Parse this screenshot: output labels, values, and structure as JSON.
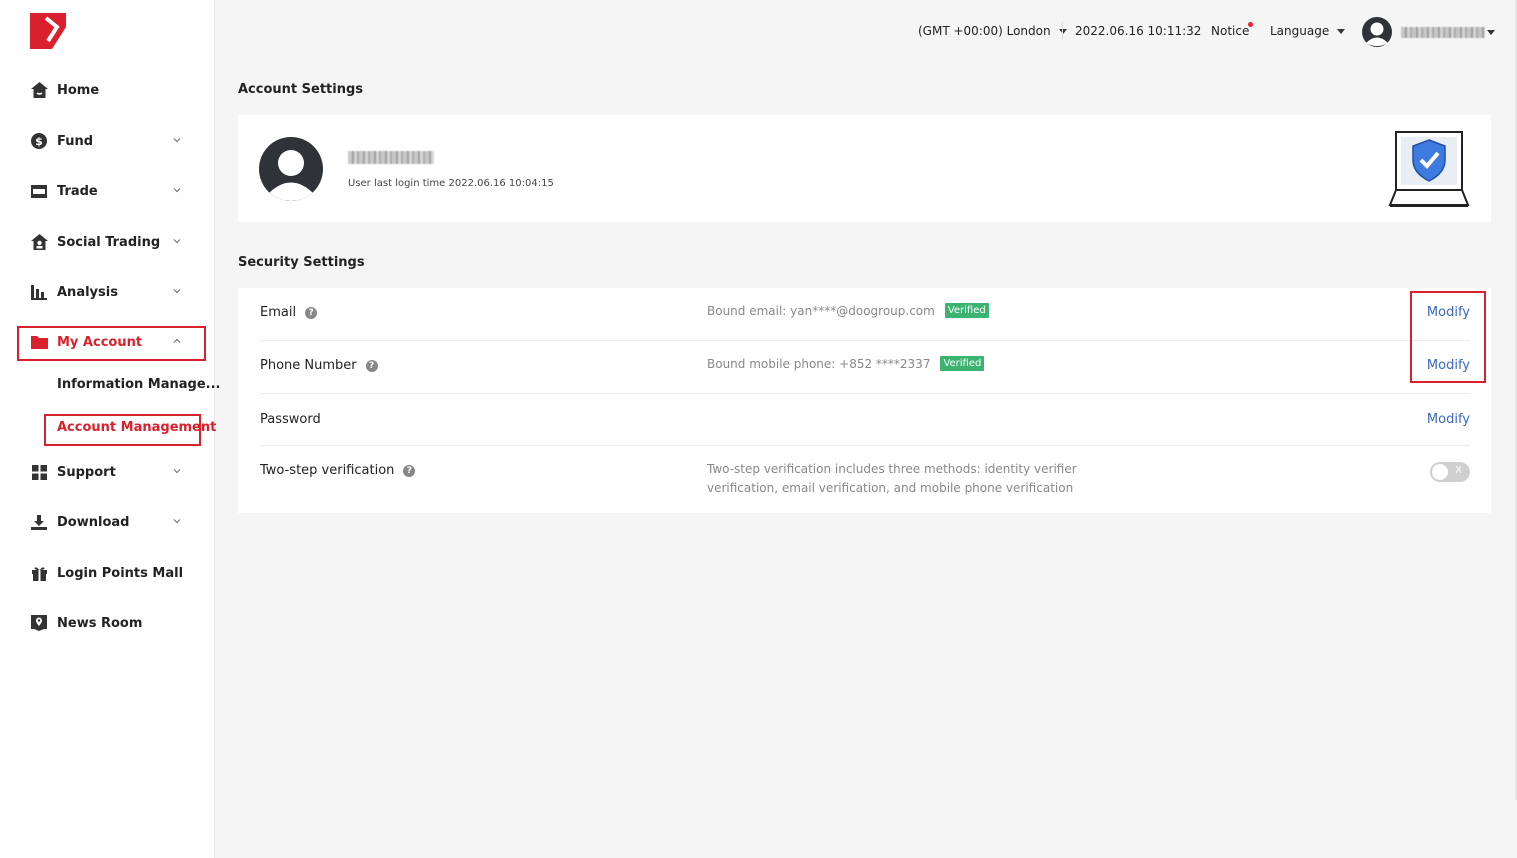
{
  "brand": {
    "accent": "#d8212c",
    "link": "#3a67c4",
    "badge_green": "#3cb371"
  },
  "sidebar": {
    "items": [
      {
        "label": "Home",
        "icon": "home-icon"
      },
      {
        "label": "Fund",
        "icon": "dollar-icon"
      },
      {
        "label": "Trade",
        "icon": "trade-card-icon"
      },
      {
        "label": "Social Trading",
        "icon": "social-house-icon"
      },
      {
        "label": "Analysis",
        "icon": "bar-chart-icon"
      },
      {
        "label": "My Account",
        "icon": "folder-icon"
      },
      {
        "label": "Support",
        "icon": "grid-icon"
      },
      {
        "label": "Download",
        "icon": "download-icon"
      },
      {
        "label": "Login Points Mall",
        "icon": "gift-icon"
      },
      {
        "label": "News Room",
        "icon": "news-pin-icon"
      }
    ],
    "sub_items": [
      {
        "label": "Information Manage..."
      },
      {
        "label": "Account Management"
      }
    ]
  },
  "topbar": {
    "timezone": "(GMT +00:00) London",
    "datetime": "2022.06.16 10:11:32",
    "notice": "Notice",
    "language": "Language"
  },
  "account": {
    "section_title": "Account Settings",
    "last_login": "User last login time 2022.06.16 10:04:15"
  },
  "security": {
    "section_title": "Security Settings",
    "rows": [
      {
        "label": "Email",
        "desc": "Bound email: yan****@doogroup.com",
        "badge": "Verified",
        "action": "Modify"
      },
      {
        "label": "Phone Number",
        "desc": "Bound mobile phone: +852 ****2337",
        "badge": "Verified",
        "action": "Modify"
      },
      {
        "label": "Password",
        "action": "Modify"
      },
      {
        "label": "Two-step verification",
        "desc_line1": "Two-step verification includes three methods: identity verifier",
        "desc_line2": "verification, email verification, and mobile phone verification",
        "toggle_mark": "X"
      }
    ]
  }
}
